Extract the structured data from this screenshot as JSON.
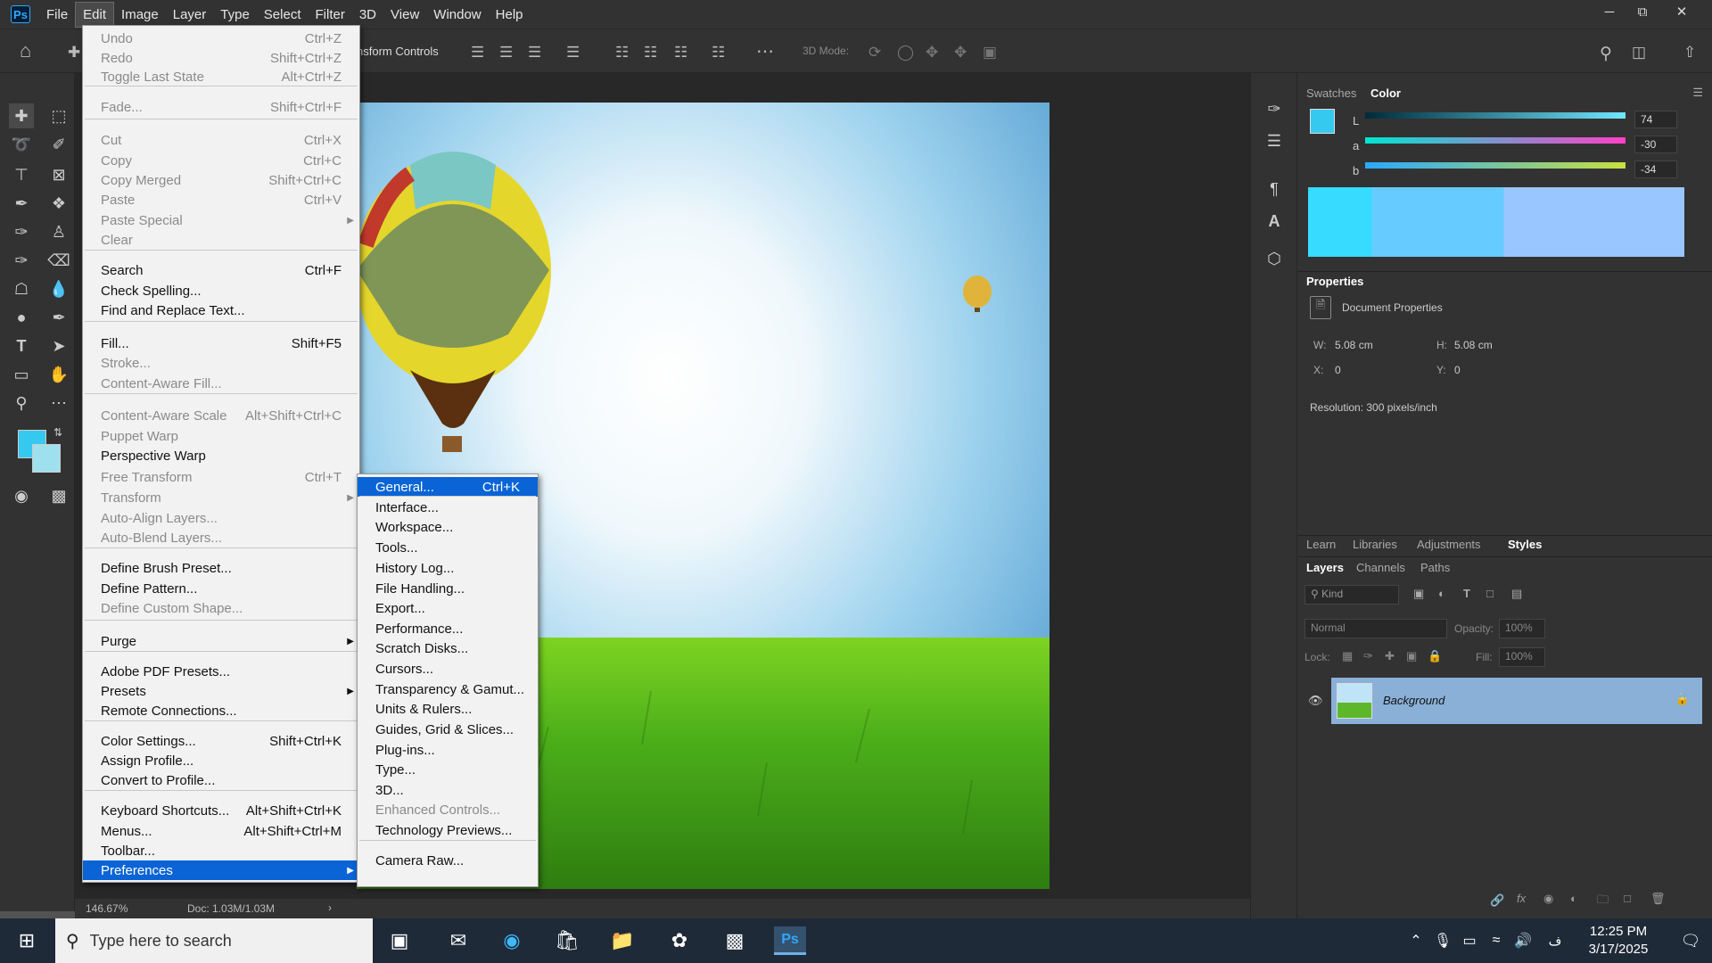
{
  "menubar": {
    "logo": "Ps",
    "items": [
      "File",
      "Edit",
      "Image",
      "Layer",
      "Type",
      "Select",
      "Filter",
      "3D",
      "View",
      "Window",
      "Help"
    ]
  },
  "options_bar": {
    "transform_label": "nsform Controls",
    "mode_label": "3D Mode:"
  },
  "edit_menu": {
    "items": [
      {
        "label": "Undo",
        "shortcut": "Ctrl+Z",
        "disabled": true
      },
      {
        "label": "Redo",
        "shortcut": "Shift+Ctrl+Z",
        "disabled": true
      },
      {
        "label": "Toggle Last State",
        "shortcut": "Alt+Ctrl+Z",
        "disabled": true
      },
      {
        "label": "Fade...",
        "shortcut": "Shift+Ctrl+F",
        "disabled": true
      },
      {
        "label": "Cut",
        "shortcut": "Ctrl+X",
        "disabled": true
      },
      {
        "label": "Copy",
        "shortcut": "Ctrl+C",
        "disabled": true
      },
      {
        "label": "Copy Merged",
        "shortcut": "Shift+Ctrl+C",
        "disabled": true
      },
      {
        "label": "Paste",
        "shortcut": "Ctrl+V",
        "disabled": true
      },
      {
        "label": "Paste Special",
        "shortcut": "",
        "disabled": true
      },
      {
        "label": "Clear",
        "shortcut": "",
        "disabled": true
      },
      {
        "label": "Search",
        "shortcut": "Ctrl+F",
        "disabled": false
      },
      {
        "label": "Check Spelling...",
        "shortcut": "",
        "disabled": false
      },
      {
        "label": "Find and Replace Text...",
        "shortcut": "",
        "disabled": false
      },
      {
        "label": "Fill...",
        "shortcut": "Shift+F5",
        "disabled": false
      },
      {
        "label": "Stroke...",
        "shortcut": "",
        "disabled": true
      },
      {
        "label": "Content-Aware Fill...",
        "shortcut": "",
        "disabled": true
      },
      {
        "label": "Content-Aware Scale",
        "shortcut": "Alt+Shift+Ctrl+C",
        "disabled": true
      },
      {
        "label": "Puppet Warp",
        "shortcut": "",
        "disabled": true
      },
      {
        "label": "Perspective Warp",
        "shortcut": "",
        "disabled": false
      },
      {
        "label": "Free Transform",
        "shortcut": "Ctrl+T",
        "disabled": true
      },
      {
        "label": "Transform",
        "shortcut": "",
        "disabled": true
      },
      {
        "label": "Auto-Align Layers...",
        "shortcut": "",
        "disabled": true
      },
      {
        "label": "Auto-Blend Layers...",
        "shortcut": "",
        "disabled": true
      },
      {
        "label": "Define Brush Preset...",
        "shortcut": "",
        "disabled": false
      },
      {
        "label": "Define Pattern...",
        "shortcut": "",
        "disabled": false
      },
      {
        "label": "Define Custom Shape...",
        "shortcut": "",
        "disabled": true
      },
      {
        "label": "Purge",
        "shortcut": "",
        "disabled": false
      },
      {
        "label": "Adobe PDF Presets...",
        "shortcut": "",
        "disabled": false
      },
      {
        "label": "Presets",
        "shortcut": "",
        "disabled": false
      },
      {
        "label": "Remote Connections...",
        "shortcut": "",
        "disabled": false
      },
      {
        "label": "Color Settings...",
        "shortcut": "Shift+Ctrl+K",
        "disabled": false
      },
      {
        "label": "Assign Profile...",
        "shortcut": "",
        "disabled": false
      },
      {
        "label": "Convert to Profile...",
        "shortcut": "",
        "disabled": false
      },
      {
        "label": "Keyboard Shortcuts...",
        "shortcut": "Alt+Shift+Ctrl+K",
        "disabled": false
      },
      {
        "label": "Menus...",
        "shortcut": "Alt+Shift+Ctrl+M",
        "disabled": false
      },
      {
        "label": "Toolbar...",
        "shortcut": "",
        "disabled": false
      },
      {
        "label": "Preferences",
        "shortcut": "",
        "disabled": false
      }
    ]
  },
  "prefs_menu": {
    "items": [
      {
        "label": "General...",
        "shortcut": "Ctrl+K",
        "disabled": false
      },
      {
        "label": "Interface...",
        "shortcut": "",
        "disabled": false
      },
      {
        "label": "Workspace...",
        "shortcut": "",
        "disabled": false
      },
      {
        "label": "Tools...",
        "shortcut": "",
        "disabled": false
      },
      {
        "label": "History Log...",
        "shortcut": "",
        "disabled": false
      },
      {
        "label": "File Handling...",
        "shortcut": "",
        "disabled": false
      },
      {
        "label": "Export...",
        "shortcut": "",
        "disabled": false
      },
      {
        "label": "Performance...",
        "shortcut": "",
        "disabled": false
      },
      {
        "label": "Scratch Disks...",
        "shortcut": "",
        "disabled": false
      },
      {
        "label": "Cursors...",
        "shortcut": "",
        "disabled": false
      },
      {
        "label": "Transparency & Gamut...",
        "shortcut": "",
        "disabled": false
      },
      {
        "label": "Units & Rulers...",
        "shortcut": "",
        "disabled": false
      },
      {
        "label": "Guides, Grid & Slices...",
        "shortcut": "",
        "disabled": false
      },
      {
        "label": "Plug-ins...",
        "shortcut": "",
        "disabled": false
      },
      {
        "label": "Type...",
        "shortcut": "",
        "disabled": false
      },
      {
        "label": "3D...",
        "shortcut": "",
        "disabled": false
      },
      {
        "label": "Enhanced Controls...",
        "shortcut": "",
        "disabled": true
      },
      {
        "label": "Technology Previews...",
        "shortcut": "",
        "disabled": false
      },
      {
        "label": "Camera Raw...",
        "shortcut": "",
        "disabled": false
      }
    ]
  },
  "status": {
    "zoom": "146.67%",
    "doc": "Doc: 1.03M/1.03M"
  },
  "color_panel": {
    "tabs": [
      "Swatches",
      "Color"
    ],
    "L_label": "L",
    "L_value": "74",
    "a_label": "a",
    "a_value": "-30",
    "b_label": "b",
    "b_value": "-34",
    "fg_color": "#35c9ef"
  },
  "properties": {
    "title": "Properties",
    "doc_label": "Document Properties",
    "w_label": "W:",
    "w_value": "5.08 cm",
    "h_label": "H:",
    "h_value": "5.08 cm",
    "x_label": "X:",
    "x_value": "0",
    "y_label": "Y:",
    "y_value": "0",
    "resolution": "Resolution: 300 pixels/inch"
  },
  "learn_tabs": [
    "Learn",
    "Libraries",
    "Adjustments",
    "Styles"
  ],
  "layers": {
    "tabs": [
      "Layers",
      "Channels",
      "Paths"
    ],
    "kind": "Kind",
    "blend": "Normal",
    "opacity_label": "Opacity:",
    "opacity": "100%",
    "lock_label": "Lock:",
    "fill_label": "Fill:",
    "fill": "100%",
    "layer_name": "Background"
  },
  "taskbar": {
    "search_placeholder": "Type here to search",
    "time": "12:25 PM",
    "date": "3/17/2025"
  }
}
